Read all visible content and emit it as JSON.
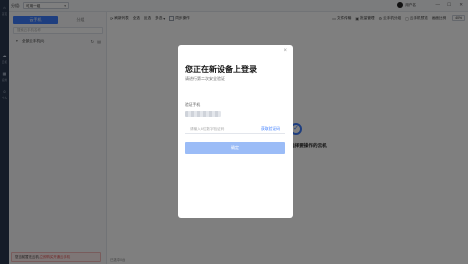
{
  "left_nav": {
    "items": [
      {
        "icon": "home-icon",
        "label": "首页"
      },
      {
        "icon": "cloud-icon",
        "label": "云机"
      },
      {
        "icon": "apps-icon",
        "label": "应用"
      },
      {
        "icon": "user-icon",
        "label": "个人"
      }
    ]
  },
  "topbar": {
    "group_label": "分组:",
    "group_value": "可用一组",
    "user_name": "用户名"
  },
  "window_controls": {
    "min": "—",
    "max": "☐",
    "close": "✕"
  },
  "sidebar": {
    "tabs": [
      "云手机",
      "分组"
    ],
    "search_placeholder": "搜索云手机名称",
    "group_name": "全部云手机(0)",
    "warning_text": "您当前暂无云机,",
    "warning_link": "立即购买开通云手机"
  },
  "toolbar": {
    "refresh": "刷新列表",
    "select_all": "全选",
    "invert": "反选",
    "more": "多选",
    "sync": "同步操作",
    "file_transfer": "文件传输",
    "batch_ops": "批量管理",
    "sort": "云手机分组",
    "mode": "云手机预览",
    "layout_label": "画面比例",
    "zoom": "40%"
  },
  "main": {
    "empty_text": "选择要操作的云机",
    "footer": "已选中0台"
  },
  "modal": {
    "title": "您正在新设备上登录",
    "subtitle": "请进行第二次安全验证",
    "phone_label": "验证手机",
    "phone_value": "",
    "code_placeholder": "请输入6位数字验证码",
    "get_code": "获取验证码",
    "confirm": "确定",
    "close": "×"
  },
  "colors": {
    "accent": "#3d7dff",
    "sidebar": "#2b3950",
    "confirm_disabled": "#9bbcf7",
    "warning": "#e24d4d"
  }
}
